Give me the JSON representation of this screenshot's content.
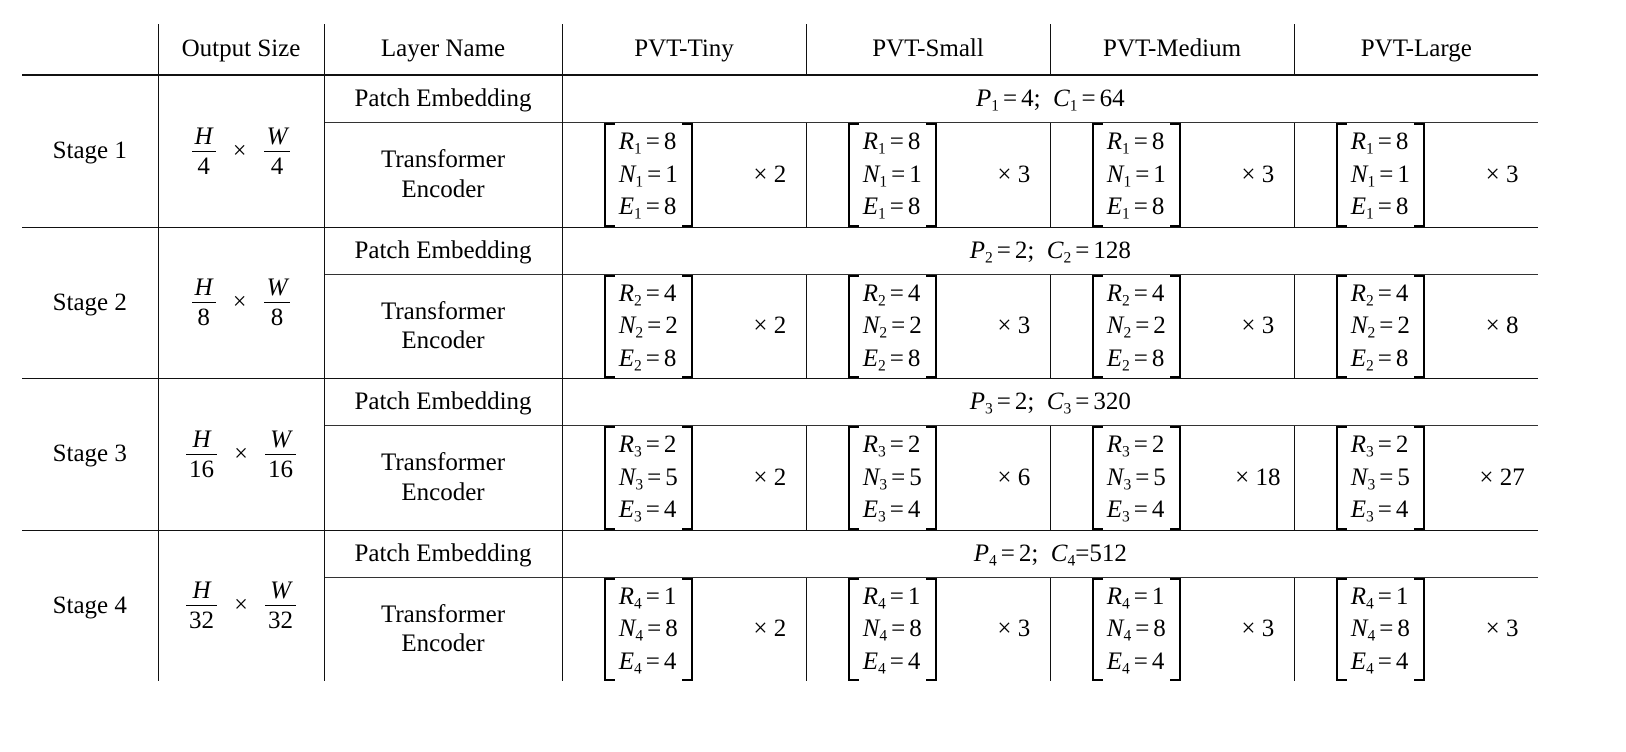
{
  "table": {
    "headers": {
      "stage": "",
      "output_size": "Output Size",
      "layer_name": "Layer Name",
      "models": [
        "PVT-Tiny",
        "PVT-Small",
        "PVT-Medium",
        "PVT-Large"
      ]
    },
    "layer_names": {
      "patch_embedding": "Patch Embedding",
      "transformer_encoder_line1": "Transformer",
      "transformer_encoder_line2": "Encoder"
    },
    "symbols": {
      "times": "×",
      "equals": "=",
      "semicolon": ";"
    },
    "stages": [
      {
        "name": "Stage 1",
        "output_size": {
          "h_num": "H",
          "h_den": "4",
          "w_num": "W",
          "w_den": "4"
        },
        "patch_embedding": {
          "p_sym": "P",
          "p_sub": "1",
          "p_val": "4",
          "c_sym": "C",
          "c_sub": "1",
          "c_val": "64",
          "text": "P1 = 4;  C1 = 64"
        },
        "encoder": {
          "r_sym": "R",
          "n_sym": "N",
          "e_sym": "E",
          "sub": "1",
          "r_val": "8",
          "n_val": "1",
          "e_val": "8"
        },
        "multipliers": [
          "2",
          "3",
          "3",
          "3"
        ]
      },
      {
        "name": "Stage 2",
        "output_size": {
          "h_num": "H",
          "h_den": "8",
          "w_num": "W",
          "w_den": "8"
        },
        "patch_embedding": {
          "p_sym": "P",
          "p_sub": "2",
          "p_val": "2",
          "c_sym": "C",
          "c_sub": "2",
          "c_val": "128",
          "text": "P2 = 2;  C2 = 128"
        },
        "encoder": {
          "r_sym": "R",
          "n_sym": "N",
          "e_sym": "E",
          "sub": "2",
          "r_val": "4",
          "n_val": "2",
          "e_val": "8"
        },
        "multipliers": [
          "2",
          "3",
          "3",
          "8"
        ]
      },
      {
        "name": "Stage 3",
        "output_size": {
          "h_num": "H",
          "h_den": "16",
          "w_num": "W",
          "w_den": "16"
        },
        "patch_embedding": {
          "p_sym": "P",
          "p_sub": "3",
          "p_val": "2",
          "c_sym": "C",
          "c_sub": "3",
          "c_val": "320",
          "text": "P3 = 2;  C3 = 320"
        },
        "encoder": {
          "r_sym": "R",
          "n_sym": "N",
          "e_sym": "E",
          "sub": "3",
          "r_val": "2",
          "n_val": "5",
          "e_val": "4"
        },
        "multipliers": [
          "2",
          "6",
          "18",
          "27"
        ]
      },
      {
        "name": "Stage 4",
        "output_size": {
          "h_num": "H",
          "h_den": "32",
          "w_num": "W",
          "w_den": "32"
        },
        "patch_embedding": {
          "p_sym": "P",
          "p_sub": "4",
          "p_val": "2",
          "c_sym": "C",
          "c_sub": "4",
          "c_val": "512",
          "text": "P4 = 2;  C4 =512"
        },
        "encoder": {
          "r_sym": "R",
          "n_sym": "N",
          "e_sym": "E",
          "sub": "4",
          "r_val": "1",
          "n_val": "8",
          "e_val": "4"
        },
        "multipliers": [
          "2",
          "3",
          "3",
          "3"
        ]
      }
    ]
  },
  "colors": {
    "text": "#000000",
    "rule": "#111111",
    "background": "#ffffff"
  }
}
